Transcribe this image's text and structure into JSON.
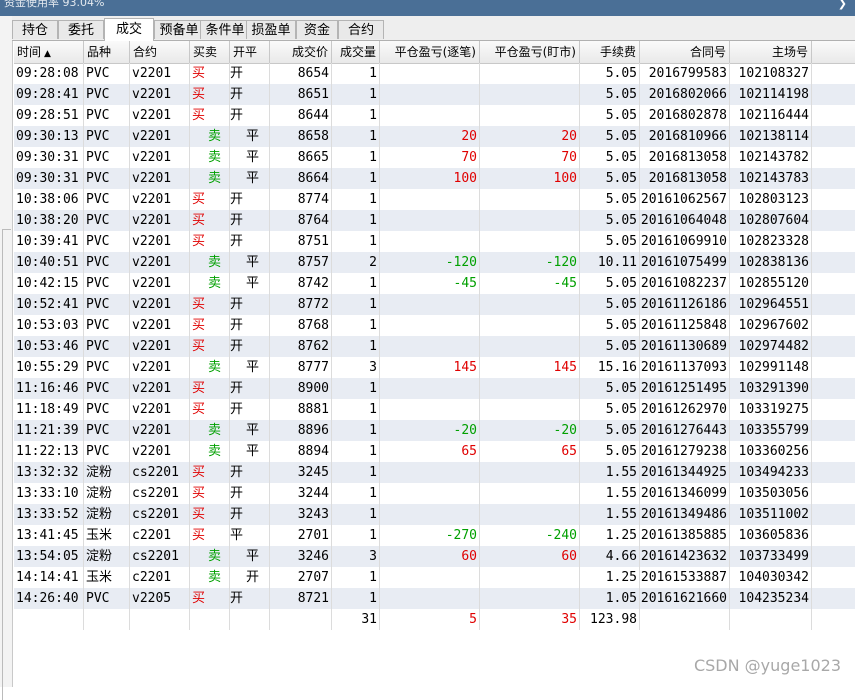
{
  "window": {
    "title": "资金使用率 93.04%"
  },
  "tabs": [
    {
      "label": "持仓",
      "active": false
    },
    {
      "label": "委托",
      "active": false
    },
    {
      "label": "成交",
      "active": true
    },
    {
      "label": "预备单",
      "active": false
    },
    {
      "label": "条件单",
      "active": false
    },
    {
      "label": "损盈单",
      "active": false
    },
    {
      "label": "资金",
      "active": false
    },
    {
      "label": "合约",
      "active": false
    }
  ],
  "columns": [
    {
      "key": "time",
      "label": "时间"
    },
    {
      "key": "product",
      "label": "品种"
    },
    {
      "key": "contract",
      "label": "合约"
    },
    {
      "key": "side",
      "label": "买卖"
    },
    {
      "key": "openclose",
      "label": "开平"
    },
    {
      "key": "price",
      "label": "成交价"
    },
    {
      "key": "qty",
      "label": "成交量"
    },
    {
      "key": "pnl_trade",
      "label": "平仓盈亏(逐笔)"
    },
    {
      "key": "pnl_mtm",
      "label": "平仓盈亏(盯市)"
    },
    {
      "key": "fee",
      "label": "手续费"
    },
    {
      "key": "contract_no",
      "label": "合同号"
    },
    {
      "key": "exch_no",
      "label": "主场号"
    }
  ],
  "rows": [
    {
      "time": "09:28:08",
      "product": "PVC",
      "contract": "v2201",
      "side": "买",
      "openclose": "开",
      "price": "8654",
      "qty": "1",
      "pnl_trade": "",
      "pnl_mtm": "",
      "fee": "5.05",
      "contract_no": "2016799583",
      "exch_no": "102108327"
    },
    {
      "time": "09:28:41",
      "product": "PVC",
      "contract": "v2201",
      "side": "买",
      "openclose": "开",
      "price": "8651",
      "qty": "1",
      "pnl_trade": "",
      "pnl_mtm": "",
      "fee": "5.05",
      "contract_no": "2016802066",
      "exch_no": "102114198"
    },
    {
      "time": "09:28:51",
      "product": "PVC",
      "contract": "v2201",
      "side": "买",
      "openclose": "开",
      "price": "8644",
      "qty": "1",
      "pnl_trade": "",
      "pnl_mtm": "",
      "fee": "5.05",
      "contract_no": "2016802878",
      "exch_no": "102116444"
    },
    {
      "time": "09:30:13",
      "product": "PVC",
      "contract": "v2201",
      "side": "卖",
      "openclose": "平",
      "price": "8658",
      "qty": "1",
      "pnl_trade": "20",
      "pnl_mtm": "20",
      "fee": "5.05",
      "contract_no": "2016810966",
      "exch_no": "102138114"
    },
    {
      "time": "09:30:31",
      "product": "PVC",
      "contract": "v2201",
      "side": "卖",
      "openclose": "平",
      "price": "8665",
      "qty": "1",
      "pnl_trade": "70",
      "pnl_mtm": "70",
      "fee": "5.05",
      "contract_no": "2016813058",
      "exch_no": "102143782"
    },
    {
      "time": "09:30:31",
      "product": "PVC",
      "contract": "v2201",
      "side": "卖",
      "openclose": "平",
      "price": "8664",
      "qty": "1",
      "pnl_trade": "100",
      "pnl_mtm": "100",
      "fee": "5.05",
      "contract_no": "2016813058",
      "exch_no": "102143783"
    },
    {
      "time": "10:38:06",
      "product": "PVC",
      "contract": "v2201",
      "side": "买",
      "openclose": "开",
      "price": "8774",
      "qty": "1",
      "pnl_trade": "",
      "pnl_mtm": "",
      "fee": "5.05",
      "contract_no": "20161062567",
      "exch_no": "102803123"
    },
    {
      "time": "10:38:20",
      "product": "PVC",
      "contract": "v2201",
      "side": "买",
      "openclose": "开",
      "price": "8764",
      "qty": "1",
      "pnl_trade": "",
      "pnl_mtm": "",
      "fee": "5.05",
      "contract_no": "20161064048",
      "exch_no": "102807604"
    },
    {
      "time": "10:39:41",
      "product": "PVC",
      "contract": "v2201",
      "side": "买",
      "openclose": "开",
      "price": "8751",
      "qty": "1",
      "pnl_trade": "",
      "pnl_mtm": "",
      "fee": "5.05",
      "contract_no": "20161069910",
      "exch_no": "102823328"
    },
    {
      "time": "10:40:51",
      "product": "PVC",
      "contract": "v2201",
      "side": "卖",
      "openclose": "平",
      "price": "8757",
      "qty": "2",
      "pnl_trade": "-120",
      "pnl_mtm": "-120",
      "fee": "10.11",
      "contract_no": "20161075499",
      "exch_no": "102838136"
    },
    {
      "time": "10:42:15",
      "product": "PVC",
      "contract": "v2201",
      "side": "卖",
      "openclose": "平",
      "price": "8742",
      "qty": "1",
      "pnl_trade": "-45",
      "pnl_mtm": "-45",
      "fee": "5.05",
      "contract_no": "20161082237",
      "exch_no": "102855120"
    },
    {
      "time": "10:52:41",
      "product": "PVC",
      "contract": "v2201",
      "side": "买",
      "openclose": "开",
      "price": "8772",
      "qty": "1",
      "pnl_trade": "",
      "pnl_mtm": "",
      "fee": "5.05",
      "contract_no": "20161126186",
      "exch_no": "102964551"
    },
    {
      "time": "10:53:03",
      "product": "PVC",
      "contract": "v2201",
      "side": "买",
      "openclose": "开",
      "price": "8768",
      "qty": "1",
      "pnl_trade": "",
      "pnl_mtm": "",
      "fee": "5.05",
      "contract_no": "20161125848",
      "exch_no": "102967602"
    },
    {
      "time": "10:53:46",
      "product": "PVC",
      "contract": "v2201",
      "side": "买",
      "openclose": "开",
      "price": "8762",
      "qty": "1",
      "pnl_trade": "",
      "pnl_mtm": "",
      "fee": "5.05",
      "contract_no": "20161130689",
      "exch_no": "102974482"
    },
    {
      "time": "10:55:29",
      "product": "PVC",
      "contract": "v2201",
      "side": "卖",
      "openclose": "平",
      "price": "8777",
      "qty": "3",
      "pnl_trade": "145",
      "pnl_mtm": "145",
      "fee": "15.16",
      "contract_no": "20161137093",
      "exch_no": "102991148"
    },
    {
      "time": "11:16:46",
      "product": "PVC",
      "contract": "v2201",
      "side": "买",
      "openclose": "开",
      "price": "8900",
      "qty": "1",
      "pnl_trade": "",
      "pnl_mtm": "",
      "fee": "5.05",
      "contract_no": "20161251495",
      "exch_no": "103291390"
    },
    {
      "time": "11:18:49",
      "product": "PVC",
      "contract": "v2201",
      "side": "买",
      "openclose": "开",
      "price": "8881",
      "qty": "1",
      "pnl_trade": "",
      "pnl_mtm": "",
      "fee": "5.05",
      "contract_no": "20161262970",
      "exch_no": "103319275"
    },
    {
      "time": "11:21:39",
      "product": "PVC",
      "contract": "v2201",
      "side": "卖",
      "openclose": "平",
      "price": "8896",
      "qty": "1",
      "pnl_trade": "-20",
      "pnl_mtm": "-20",
      "fee": "5.05",
      "contract_no": "20161276443",
      "exch_no": "103355799"
    },
    {
      "time": "11:22:13",
      "product": "PVC",
      "contract": "v2201",
      "side": "卖",
      "openclose": "平",
      "price": "8894",
      "qty": "1",
      "pnl_trade": "65",
      "pnl_mtm": "65",
      "fee": "5.05",
      "contract_no": "20161279238",
      "exch_no": "103360256"
    },
    {
      "time": "13:32:32",
      "product": "淀粉",
      "contract": "cs2201",
      "side": "买",
      "openclose": "开",
      "price": "3245",
      "qty": "1",
      "pnl_trade": "",
      "pnl_mtm": "",
      "fee": "1.55",
      "contract_no": "20161344925",
      "exch_no": "103494233"
    },
    {
      "time": "13:33:10",
      "product": "淀粉",
      "contract": "cs2201",
      "side": "买",
      "openclose": "开",
      "price": "3244",
      "qty": "1",
      "pnl_trade": "",
      "pnl_mtm": "",
      "fee": "1.55",
      "contract_no": "20161346099",
      "exch_no": "103503056"
    },
    {
      "time": "13:33:52",
      "product": "淀粉",
      "contract": "cs2201",
      "side": "买",
      "openclose": "开",
      "price": "3243",
      "qty": "1",
      "pnl_trade": "",
      "pnl_mtm": "",
      "fee": "1.55",
      "contract_no": "20161349486",
      "exch_no": "103511002"
    },
    {
      "time": "13:41:45",
      "product": "玉米",
      "contract": "c2201",
      "side": "买",
      "openclose": "平",
      "price": "2701",
      "qty": "1",
      "pnl_trade": "-270",
      "pnl_mtm": "-240",
      "fee": "1.25",
      "contract_no": "20161385885",
      "exch_no": "103605836"
    },
    {
      "time": "13:54:05",
      "product": "淀粉",
      "contract": "cs2201",
      "side": "卖",
      "openclose": "平",
      "price": "3246",
      "qty": "3",
      "pnl_trade": "60",
      "pnl_mtm": "60",
      "fee": "4.66",
      "contract_no": "20161423632",
      "exch_no": "103733499"
    },
    {
      "time": "14:14:41",
      "product": "玉米",
      "contract": "c2201",
      "side": "卖",
      "openclose": "开",
      "price": "2707",
      "qty": "1",
      "pnl_trade": "",
      "pnl_mtm": "",
      "fee": "1.25",
      "contract_no": "20161533887",
      "exch_no": "104030342"
    },
    {
      "time": "14:26:40",
      "product": "PVC",
      "contract": "v2205",
      "side": "买",
      "openclose": "开",
      "price": "8721",
      "qty": "1",
      "pnl_trade": "",
      "pnl_mtm": "",
      "fee": "1.05",
      "contract_no": "20161621660",
      "exch_no": "104235234"
    }
  ],
  "totals": {
    "qty": "31",
    "pnl_trade": "5",
    "pnl_mtm": "35",
    "fee": "123.98"
  },
  "watermark": "CSDN @yuge1023",
  "colors": {
    "buy": "#e00000",
    "sell": "#00a000",
    "positive": "#e00000",
    "negative": "#00a000",
    "row_alt": "#e8ecf3"
  },
  "icons": {
    "sort": "sort-asc-icon"
  }
}
